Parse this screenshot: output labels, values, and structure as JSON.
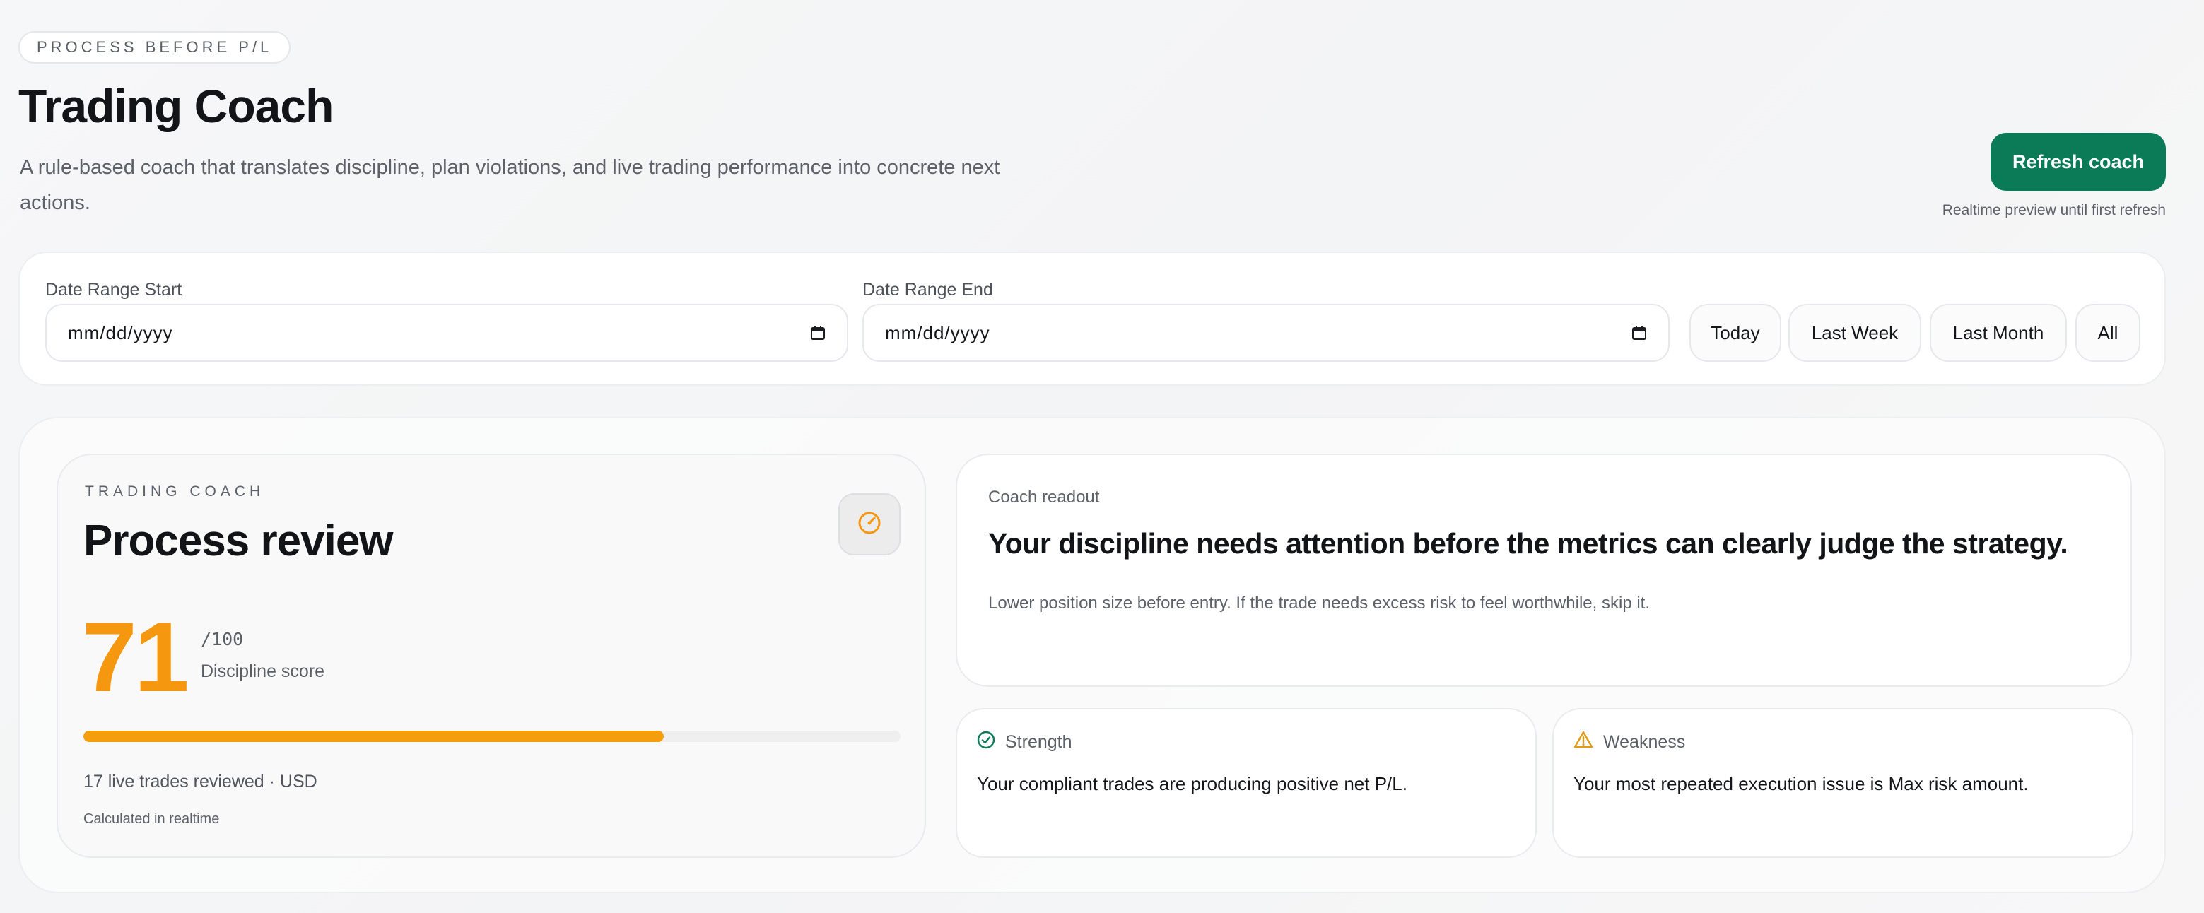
{
  "header": {
    "eyebrow": "PROCESS BEFORE P/L",
    "title": "Trading Coach",
    "subtitle": "A rule-based coach that translates discipline, plan violations, and live trading performance into concrete next actions.",
    "refresh_label": "Refresh coach",
    "refresh_hint": "Realtime preview until first refresh"
  },
  "filters": {
    "start_label": "Date Range Start",
    "start_value": "mm/dd/yyyy",
    "end_label": "Date Range End",
    "end_value": "mm/dd/yyyy",
    "ranges": [
      "Today",
      "Last Week",
      "Last Month",
      "All"
    ]
  },
  "score_card": {
    "eyebrow": "TRADING COACH",
    "title": "Process review",
    "score": "71",
    "score_max": "/100",
    "score_label": "Discipline score",
    "progress_fraction": 0.71,
    "trades_line": "17 live trades reviewed · USD",
    "calc_line": "Calculated in realtime",
    "icon": "gauge-icon",
    "accent": "#f5970f"
  },
  "readout": {
    "eyebrow": "Coach readout",
    "headline": "Your discipline needs attention before the metrics can clearly judge the strategy.",
    "body": "Lower position size before entry. If the trade needs excess risk to feel worthwhile, skip it."
  },
  "strength": {
    "label": "Strength",
    "icon": "check-circle-icon",
    "color": "#0b7a57",
    "text": "Your compliant trades are producing positive net P/L."
  },
  "weakness": {
    "label": "Weakness",
    "icon": "warning-icon",
    "color": "#e09a16",
    "text": "Your most repeated execution issue is Max risk amount."
  },
  "colors": {
    "brand": "#0b7a57",
    "score": "#f5970f"
  }
}
